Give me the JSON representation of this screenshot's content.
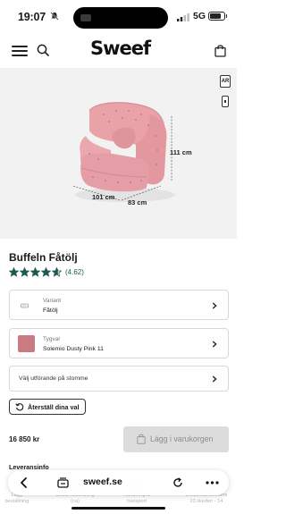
{
  "status_bar": {
    "time": "19:07",
    "network": "5G"
  },
  "header": {
    "logo": "Sweef"
  },
  "hero": {
    "ar_label": "AR",
    "dimensions": {
      "height": "111 cm",
      "width": "101 cm",
      "depth": "83 cm"
    }
  },
  "product": {
    "title": "Buffeln Fåtölj",
    "rating": 4.62,
    "rating_text": "(4.62)",
    "stars_max": 5,
    "price": "16 850 kr"
  },
  "options": {
    "variant": {
      "label": "Variant",
      "value": "Fåtölj"
    },
    "fabric": {
      "label": "Tygval",
      "value": "Solemio Dusty Pink 11",
      "swatch_color": "#c97b83"
    },
    "frame": {
      "label": "Välj utförande på stomme"
    }
  },
  "reset_label": "Återställ dina val",
  "add_to_cart_label": "Lägg i varukorgen",
  "delivery": {
    "heading": "Leveransinfo",
    "items": [
      {
        "line1": "Lagg",
        "line2": "beställning"
      },
      {
        "line1": "Under tillverkning",
        "line2": "(ca)"
      },
      {
        "line1": "Hantering &",
        "line2": "transport"
      },
      {
        "line1": "Beräknad leverans",
        "line2": "23 skeden - 14"
      }
    ]
  },
  "browser": {
    "url": "sweef.se"
  },
  "colors": {
    "accent": "#1e5a52",
    "sofa": "#e8a2a8",
    "button_disabled": "#dcdcdc"
  }
}
